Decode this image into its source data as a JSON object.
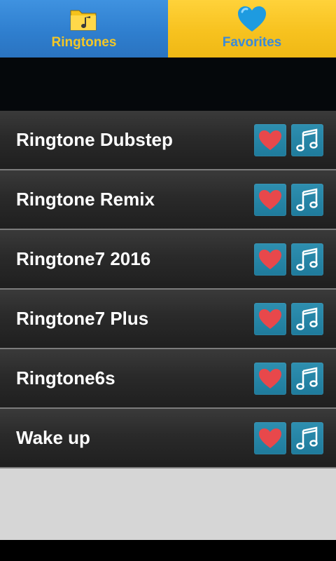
{
  "tabs": {
    "ringtones": {
      "label": "Ringtones",
      "icon": "folder-music-icon",
      "color": "#2f7fcf"
    },
    "favorites": {
      "label": "Favorites",
      "icon": "heart-icon",
      "color": "#f7c21f"
    }
  },
  "ringtones": [
    {
      "title": "Ringtone Dubstep"
    },
    {
      "title": "Ringtone Remix"
    },
    {
      "title": "Ringtone7 2016"
    },
    {
      "title": "Ringtone7 Plus"
    },
    {
      "title": "Ringtone6s"
    },
    {
      "title": "Wake up"
    }
  ],
  "colors": {
    "accent_blue": "#2f7fcf",
    "accent_yellow": "#f7c21f",
    "button_teal": "#2589aa",
    "heart_red": "#e8484b"
  }
}
